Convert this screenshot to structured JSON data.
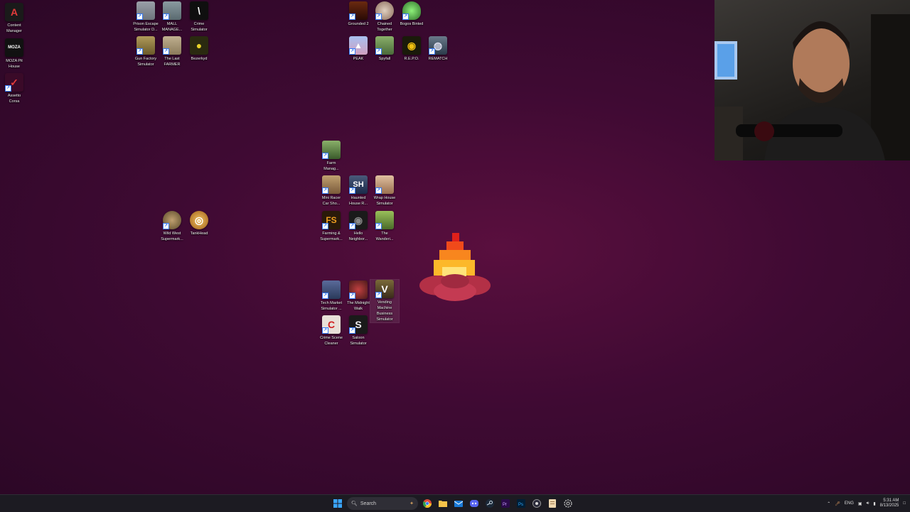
{
  "desktop": {
    "icons": [
      {
        "label": "Content\nManager",
        "color": "#1a1a1a",
        "glyph": "A",
        "fg": "#e23b3b"
      },
      {
        "label": "MOZA Pit\nHouse",
        "color": "#111111",
        "glyph": "MOZA",
        "fg": "#ffffff"
      },
      {
        "label": "Assetto\nCorsa",
        "color": "#3a0a28",
        "glyph": "✓",
        "fg": "#e23b3b"
      },
      {
        "label": "Prison Escape\nSimulator D...",
        "color": "#8a8f96",
        "glyph": "",
        "fg": "#fff"
      },
      {
        "label": "MALL\nMANAGE...",
        "color": "#7b8a8f",
        "glyph": "",
        "fg": "#fff"
      },
      {
        "label": "Crime\nSimulator",
        "color": "#0f0f0f",
        "glyph": "\\",
        "fg": "#fff"
      },
      {
        "label": "Gun Factory\nSimulator",
        "color": "#7a6a3a",
        "glyph": "",
        "fg": "#fff"
      },
      {
        "label": "The Last\nFARMER",
        "color": "#a89a7a",
        "glyph": "",
        "fg": "#fff"
      },
      {
        "label": "Bezerkyd",
        "color": "#2a2a10",
        "glyph": "●",
        "fg": "#e8d22a"
      },
      {
        "label": "Grounded 2",
        "color": "#3a1a10",
        "glyph": "",
        "fg": "#fff"
      },
      {
        "label": "Chained\nTogether",
        "color": "#b8a89a",
        "glyph": "",
        "fg": "#fff"
      },
      {
        "label": "Bogos Binted",
        "color": "#2f6f2a",
        "glyph": "",
        "fg": "#7ee06a"
      },
      {
        "label": "PEAK",
        "color": "#8aa8d8",
        "glyph": "▲",
        "fg": "#fff"
      },
      {
        "label": "Spyfall",
        "color": "#6f8f5a",
        "glyph": "",
        "fg": "#fff"
      },
      {
        "label": "R.E.P.O.",
        "color": "#1a1a0a",
        "glyph": "◉",
        "fg": "#f0c010"
      },
      {
        "label": "REMATCH",
        "color": "#4a5a6a",
        "glyph": "◍",
        "fg": "#dde"
      },
      {
        "label": "Farm\nManag...",
        "color": "#5a7a4a",
        "glyph": "",
        "fg": "#fff"
      },
      {
        "label": "Mini Racer\nCar Sho...",
        "color": "#9a7a5a",
        "glyph": "",
        "fg": "#fff"
      },
      {
        "label": "Haunted\nHouse R...",
        "color": "#2a3a5a",
        "glyph": "SH",
        "fg": "#fff"
      },
      {
        "label": "Wrap House\nSimulator",
        "color": "#b89070",
        "glyph": "",
        "fg": "#fff"
      },
      {
        "label": "Wild West\nSupermark...",
        "color": "#8a7a5a",
        "glyph": "",
        "fg": "#fff"
      },
      {
        "label": "TankHead",
        "color": "#c8902a",
        "glyph": "◎",
        "fg": "#fff"
      },
      {
        "label": "Farming &\nSupermark...",
        "color": "#2a1a0a",
        "glyph": "FS",
        "fg": "#f0a020"
      },
      {
        "label": "Hello\nNeighbor...",
        "color": "#1a1a1a",
        "glyph": "◉",
        "fg": "#888"
      },
      {
        "label": "The\nWanderi...",
        "color": "#6a8a3a",
        "glyph": "",
        "fg": "#fff"
      },
      {
        "label": "Tech Market\nSimulator ...",
        "color": "#3a4a6a",
        "glyph": "",
        "fg": "#fff"
      },
      {
        "label": "The Midnight\nWalk",
        "color": "#6a2a2a",
        "glyph": "",
        "fg": "#fff"
      },
      {
        "label": "Vending\nMachine\nBusiness\nSimulator",
        "color": "#5a4a2a",
        "glyph": "V",
        "fg": "#fff"
      },
      {
        "label": "Crime Scene\nCleaner",
        "color": "#d8d0c8",
        "glyph": "C",
        "fg": "#d02020"
      },
      {
        "label": "Saloon\nSimulator",
        "color": "#1a1a1a",
        "glyph": "S",
        "fg": "#eee"
      }
    ]
  },
  "taskbar": {
    "search_label": "Search",
    "language": "ENG",
    "time": "5:31 AM",
    "date": "8/13/2025"
  }
}
